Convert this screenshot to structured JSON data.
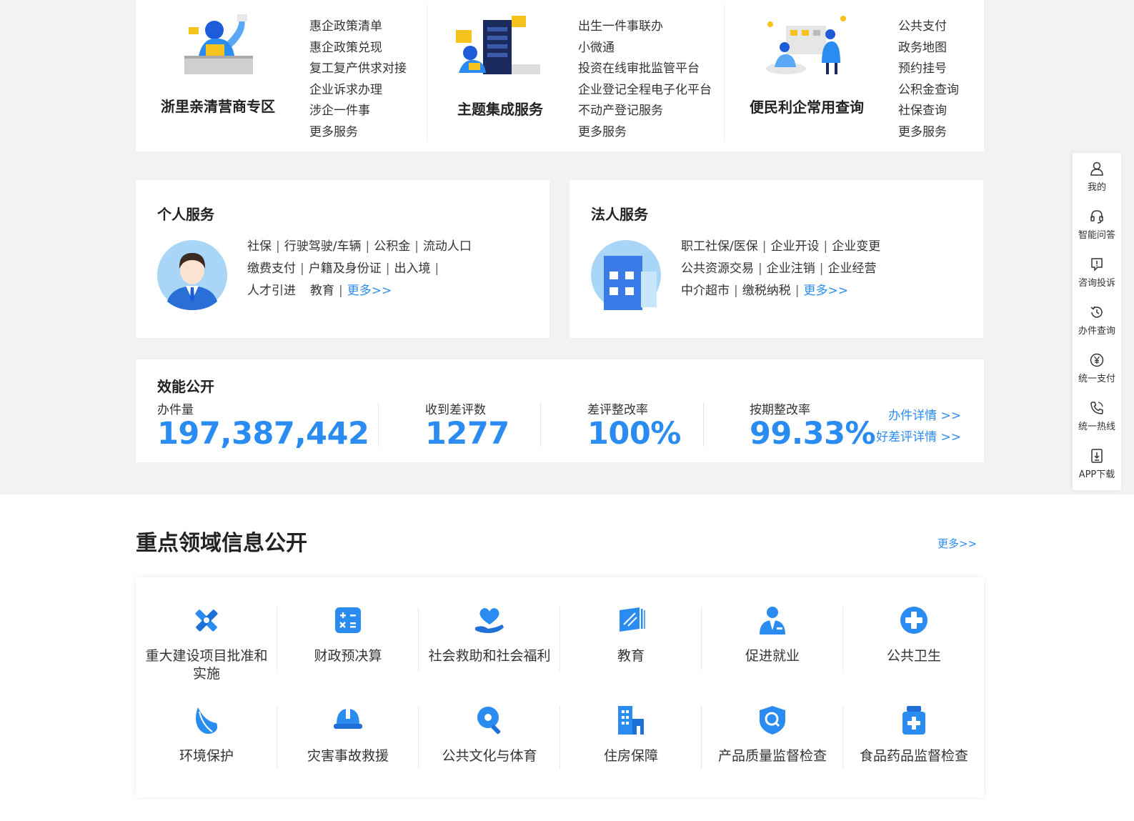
{
  "top_services": [
    {
      "title": "浙里亲清营商专区",
      "links": [
        "惠企政策清单",
        "惠企政策兑现",
        "复工复产供求对接",
        "企业诉求办理",
        "涉企一件事",
        "更多服务"
      ]
    },
    {
      "title": "主题集成服务",
      "links": [
        "出生一件事联办",
        "小微通",
        "投资在线审批监管平台",
        "企业登记全程电子化平台",
        "不动产登记服务",
        "更多服务"
      ]
    },
    {
      "title": "便民利企常用查询",
      "links": [
        "公共支付",
        "政务地图",
        "预约挂号",
        "公积金查询",
        "社保查询",
        "更多服务"
      ]
    }
  ],
  "personal": {
    "title": "个人服务",
    "lines": [
      [
        "社保",
        "行驶驾驶/车辆",
        "公积金",
        "流动人口"
      ],
      [
        "缴费支付",
        "户籍及身份证",
        "出入境"
      ],
      [
        "人才引进",
        "教育"
      ]
    ],
    "more": "更多>>"
  },
  "legal": {
    "title": "法人服务",
    "lines": [
      [
        "职工社保/医保",
        "企业开设",
        "企业变更"
      ],
      [
        "公共资源交易",
        "企业注销",
        "企业经营"
      ],
      [
        "中介超市",
        "缴税纳税"
      ]
    ],
    "more": "更多>>"
  },
  "performance": {
    "title": "效能公开",
    "stats": [
      {
        "label": "办件量",
        "value": "197,387,442"
      },
      {
        "label": "收到差评数",
        "value": "1277"
      },
      {
        "label": "差评整改率",
        "value": "100%"
      },
      {
        "label": "按期整改率",
        "value": "99.33%"
      }
    ],
    "link_detail": "办件详情 >>",
    "link_review": "好差评详情 >>"
  },
  "key_info": {
    "title": "重点领域信息公开",
    "more": "更多>>",
    "items": [
      {
        "label": "重大建设项目批准和实施",
        "icon": "construction-icon"
      },
      {
        "label": "财政预决算",
        "icon": "calculator-icon"
      },
      {
        "label": "社会救助和社会福利",
        "icon": "heart-hand-icon"
      },
      {
        "label": "教育",
        "icon": "book-icon"
      },
      {
        "label": "促进就业",
        "icon": "employee-icon"
      },
      {
        "label": "公共卫生",
        "icon": "medical-cross-icon"
      },
      {
        "label": "环境保护",
        "icon": "leaf-icon"
      },
      {
        "label": "灾害事故救援",
        "icon": "helmet-icon"
      },
      {
        "label": "公共文化与体育",
        "icon": "pingpong-icon"
      },
      {
        "label": "住房保障",
        "icon": "building-icon"
      },
      {
        "label": "产品质量监督检查",
        "icon": "shield-search-icon"
      },
      {
        "label": "食品药品监督检查",
        "icon": "medicine-bottle-icon"
      }
    ]
  },
  "float_bar": [
    {
      "label": "我的",
      "icon": "user-icon"
    },
    {
      "label": "智能问答",
      "icon": "headset-icon"
    },
    {
      "label": "咨询投诉",
      "icon": "complaint-icon"
    },
    {
      "label": "办件查询",
      "icon": "history-icon"
    },
    {
      "label": "统一支付",
      "icon": "yuan-icon"
    },
    {
      "label": "统一热线",
      "icon": "phone-icon"
    },
    {
      "label": "APP下载",
      "icon": "download-icon"
    }
  ],
  "colors": {
    "accent": "#2a8cf0",
    "icon_blue": "#2a8cf0",
    "bg_grey": "#f2f2f2"
  }
}
